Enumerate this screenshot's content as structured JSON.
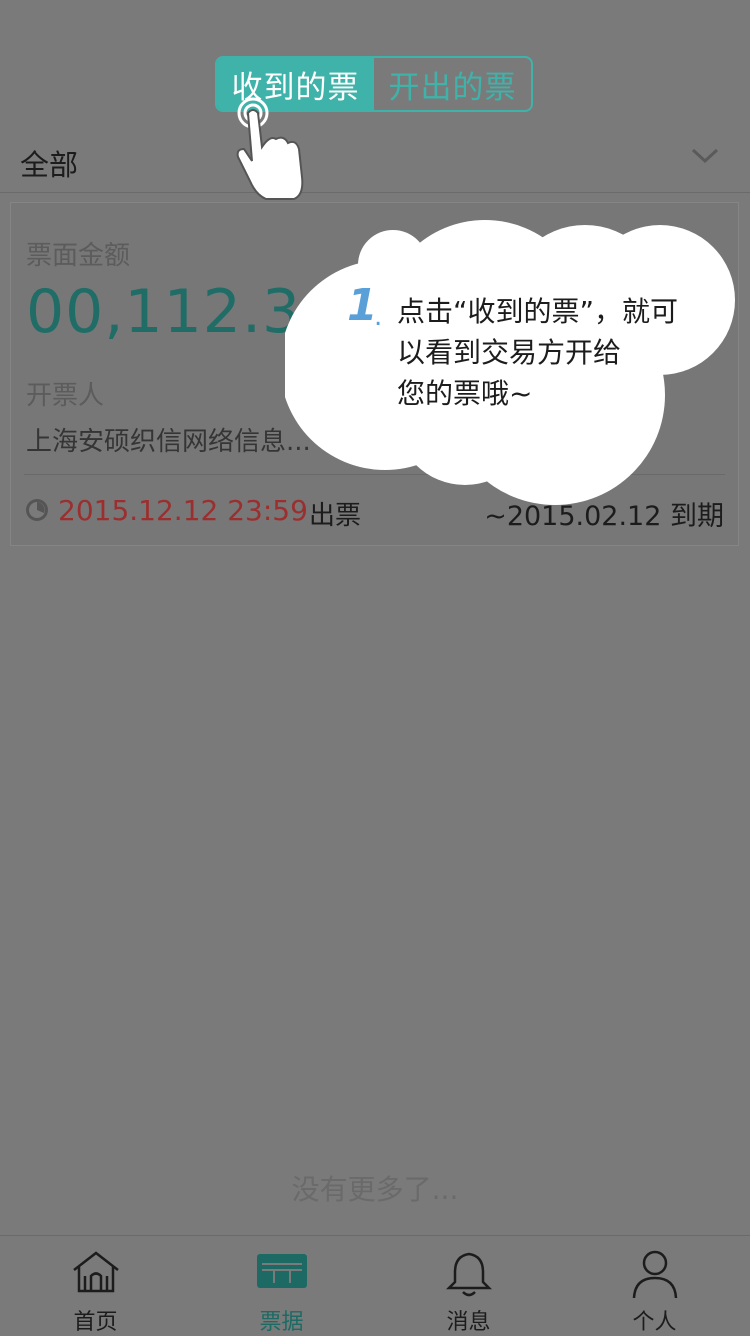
{
  "segment": {
    "received": "收到的票",
    "issued": "开出的票"
  },
  "filter": {
    "label": "全部"
  },
  "card": {
    "amount_label": "票面金额",
    "amount": "00,112.34",
    "issuer_label": "开票人",
    "issuer": "上海安硕织信网络信息...",
    "issue_date": "2015.12.12 23:59",
    "issue_tag": "出票",
    "due_text": "~2015.02.12  到期"
  },
  "no_more": "没有更多了...",
  "tooltip": {
    "step": "1",
    "dot": ".",
    "line1": "点击“收到的票”，就可",
    "line2": "以看到交易方开给",
    "line3": "您的票哦~"
  },
  "tabs": [
    {
      "label": "首页",
      "icon": "home-icon"
    },
    {
      "label": "票据",
      "icon": "ticket-icon"
    },
    {
      "label": "消息",
      "icon": "bell-icon"
    },
    {
      "label": "个人",
      "icon": "person-icon"
    }
  ],
  "colors": {
    "accent": "#3fb3aa",
    "amount": "#1f6d66",
    "date": "#9b2f2f",
    "tip_number": "#5aa0d8"
  }
}
